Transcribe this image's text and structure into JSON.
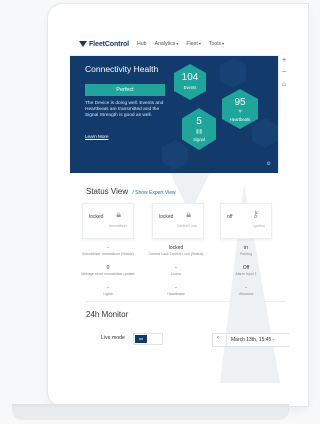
{
  "nav": {
    "logo": "FleetControl",
    "items": [
      {
        "label": "Hub",
        "dropdown": false
      },
      {
        "label": "Analytics",
        "dropdown": true
      },
      {
        "label": "Fleet",
        "dropdown": true
      },
      {
        "label": "Tools",
        "dropdown": true
      }
    ]
  },
  "map_controls": {
    "zoom_in": "+",
    "zoom_out": "−",
    "home_icon": "home-icon"
  },
  "hero": {
    "title": "Connectivity Health",
    "status_button": "Perfect",
    "description": "The Device is doing well. Events and Heartbeats are transmitted and the Signal Strength is good as well.",
    "learn_more": "Learn More",
    "hexagons": [
      {
        "value": "104",
        "label": "Events"
      },
      {
        "value": "95",
        "label": "Heartbeats"
      },
      {
        "value": "5",
        "label": "Signal"
      }
    ]
  },
  "status_view": {
    "title": "Status View",
    "link": "Show Expert View",
    "cards": [
      {
        "state": "locked",
        "icon": "lock-icon",
        "sub": "Immobilizer"
      },
      {
        "state": "locked",
        "icon": "lock-icon",
        "sub": "Central Lock"
      },
      {
        "state": "off",
        "icon": "key-icon",
        "sub": "Ignition"
      }
    ],
    "metrics_row1": [
      {
        "value": "-",
        "key": "Immobilizer Immobilizer (Status)"
      },
      {
        "value": "locked",
        "key": "Central Lock Central Lock (Status)"
      },
      {
        "value": "in",
        "key": "Parking"
      }
    ],
    "metrics_row2": [
      {
        "value": "0",
        "key": "Mileage since immobilizer update"
      },
      {
        "value": "-",
        "key": "Doors"
      },
      {
        "value": "Off",
        "key": "Alarm Input 1"
      }
    ],
    "metrics_row3": [
      {
        "value": "-",
        "key": "Lights"
      },
      {
        "value": "-",
        "key": "Handbrake"
      },
      {
        "value": "-",
        "key": "Windows"
      }
    ]
  },
  "monitor": {
    "title": "24h Monitor",
    "live_mode_label": "Live mode",
    "toggle_on": "on",
    "date": "March 13th, 15:45 -"
  },
  "colors": {
    "primary": "#123a6b",
    "accent": "#1fa69a",
    "link": "#1b6fb3"
  }
}
